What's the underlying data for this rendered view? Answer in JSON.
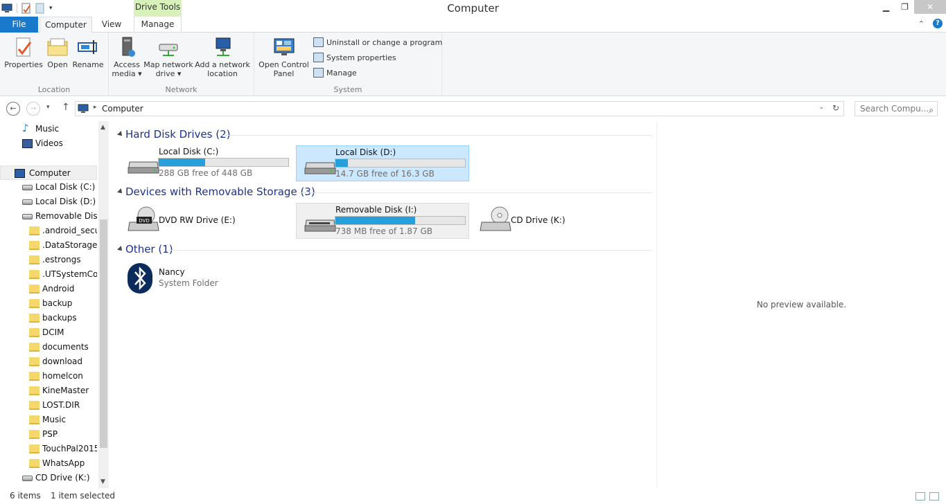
{
  "window": {
    "title": "Computer",
    "contextual_tab_header": "Drive Tools"
  },
  "ribbon": {
    "tabs": {
      "file": "File",
      "computer": "Computer",
      "view": "View",
      "manage": "Manage"
    },
    "groups": {
      "location": {
        "label": "Location",
        "properties": "Properties",
        "open": "Open",
        "rename": "Rename"
      },
      "network": {
        "label": "Network",
        "access_media": [
          "Access",
          "media ▾"
        ],
        "map_network_drive": [
          "Map network",
          "drive ▾"
        ],
        "add_network_location": [
          "Add a network",
          "location"
        ]
      },
      "system": {
        "label": "System",
        "open_control_panel": [
          "Open Control",
          "Panel"
        ],
        "uninstall": "Uninstall or change a program",
        "system_properties": "System properties",
        "manage": "Manage"
      }
    }
  },
  "address_bar": {
    "path": "Computer",
    "search_placeholder": "Search Compu..."
  },
  "nav_pane": {
    "items": [
      {
        "label": "Music",
        "icon": "music-icon"
      },
      {
        "label": "Videos",
        "icon": "videos-icon"
      },
      {
        "label": "Computer",
        "icon": "computer-icon"
      },
      {
        "label": "Local Disk (C:)",
        "icon": "drive-icon"
      },
      {
        "label": "Local Disk (D:)",
        "icon": "drive-icon"
      },
      {
        "label": "Removable Disk (",
        "icon": "removable-drive-icon"
      },
      {
        "label": ".android_secure",
        "icon": "folder-icon"
      },
      {
        "label": ".DataStorage",
        "icon": "folder-icon"
      },
      {
        "label": ".estrongs",
        "icon": "folder-icon"
      },
      {
        "label": ".UTSystemConf",
        "icon": "folder-icon"
      },
      {
        "label": "Android",
        "icon": "folder-icon"
      },
      {
        "label": "backup",
        "icon": "folder-icon"
      },
      {
        "label": "backups",
        "icon": "folder-icon"
      },
      {
        "label": "DCIM",
        "icon": "folder-icon"
      },
      {
        "label": "documents",
        "icon": "folder-icon"
      },
      {
        "label": "download",
        "icon": "folder-icon"
      },
      {
        "label": "homelcon",
        "icon": "folder-icon"
      },
      {
        "label": "KineMaster",
        "icon": "folder-icon"
      },
      {
        "label": "LOST.DIR",
        "icon": "folder-icon"
      },
      {
        "label": "Music",
        "icon": "folder-icon"
      },
      {
        "label": "PSP",
        "icon": "folder-icon"
      },
      {
        "label": "TouchPal2015",
        "icon": "folder-icon"
      },
      {
        "label": "WhatsApp",
        "icon": "folder-icon"
      },
      {
        "label": "CD Drive (K:)",
        "icon": "cd-drive-icon"
      }
    ]
  },
  "content": {
    "groups": {
      "hdd": "Hard Disk Drives (2)",
      "removable": "Devices with Removable Storage (3)",
      "other": "Other (1)"
    },
    "drives": {
      "c": {
        "name": "Local Disk (C:)",
        "free": "288 GB free of 448 GB",
        "used_fraction": 0.357
      },
      "d": {
        "name": "Local Disk (D:)",
        "free": "14.7 GB free of 16.3 GB",
        "used_fraction": 0.098
      },
      "e": {
        "name": "DVD RW Drive (E:)"
      },
      "i": {
        "name": "Removable Disk (I:)",
        "free": "738 MB free of 1.87 GB",
        "used_fraction": 0.615
      },
      "k": {
        "name": "CD Drive (K:)"
      },
      "nancy": {
        "name": "Nancy",
        "type": "System Folder"
      }
    }
  },
  "preview": {
    "text": "No preview available."
  },
  "status": {
    "items": "6 items",
    "selected": "1 item selected"
  },
  "colors": {
    "accent": "#1979ca",
    "bar_fill": "#26a0da",
    "drive_tools": "#d8f0ba",
    "group_title": "#1e3287"
  }
}
